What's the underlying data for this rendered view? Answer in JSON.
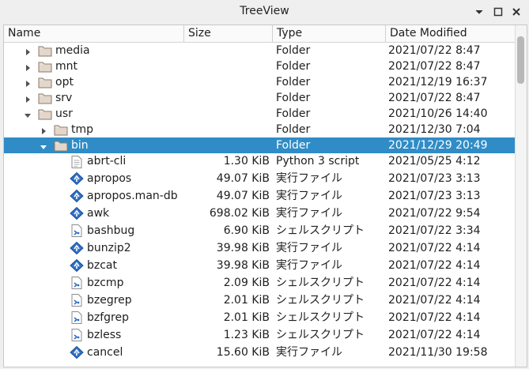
{
  "window": {
    "title": "TreeView"
  },
  "columns": {
    "name": "Name",
    "size": "Size",
    "type": "Type",
    "date": "Date Modified"
  },
  "rows": [
    {
      "name": "media",
      "size": "",
      "type": "Folder",
      "date": "2021/07/22 8:47",
      "depth": 0,
      "kind": "folder",
      "arrow": "right",
      "selected": false
    },
    {
      "name": "mnt",
      "size": "",
      "type": "Folder",
      "date": "2021/07/22 8:47",
      "depth": 0,
      "kind": "folder",
      "arrow": "right",
      "selected": false
    },
    {
      "name": "opt",
      "size": "",
      "type": "Folder",
      "date": "2021/12/19 16:37",
      "depth": 0,
      "kind": "folder",
      "arrow": "right",
      "selected": false
    },
    {
      "name": "srv",
      "size": "",
      "type": "Folder",
      "date": "2021/07/22 8:47",
      "depth": 0,
      "kind": "folder",
      "arrow": "right",
      "selected": false
    },
    {
      "name": "usr",
      "size": "",
      "type": "Folder",
      "date": "2021/10/26 14:40",
      "depth": 0,
      "kind": "folder",
      "arrow": "down",
      "selected": false
    },
    {
      "name": "tmp",
      "size": "",
      "type": "Folder",
      "date": "2021/12/30 7:04",
      "depth": 1,
      "kind": "folder",
      "arrow": "right",
      "selected": false
    },
    {
      "name": "bin",
      "size": "",
      "type": "Folder",
      "date": "2021/12/29 20:49",
      "depth": 1,
      "kind": "folder",
      "arrow": "down",
      "selected": true
    },
    {
      "name": "abrt-cli",
      "size": "1.30 KiB",
      "type": "Python 3 script",
      "date": "2021/05/25 4:12",
      "depth": 2,
      "kind": "text",
      "arrow": "",
      "selected": false
    },
    {
      "name": "apropos",
      "size": "49.07 KiB",
      "type": "実行ファイル",
      "date": "2021/07/23 3:13",
      "depth": 2,
      "kind": "exec",
      "arrow": "",
      "selected": false
    },
    {
      "name": "apropos.man-db",
      "size": "49.07 KiB",
      "type": "実行ファイル",
      "date": "2021/07/23 3:13",
      "depth": 2,
      "kind": "exec",
      "arrow": "",
      "selected": false
    },
    {
      "name": "awk",
      "size": "698.02 KiB",
      "type": "実行ファイル",
      "date": "2021/07/22 9:54",
      "depth": 2,
      "kind": "exec",
      "arrow": "",
      "selected": false
    },
    {
      "name": "bashbug",
      "size": "6.90 KiB",
      "type": "シェルスクリプト",
      "date": "2021/07/22 3:34",
      "depth": 2,
      "kind": "script",
      "arrow": "",
      "selected": false
    },
    {
      "name": "bunzip2",
      "size": "39.98 KiB",
      "type": "実行ファイル",
      "date": "2021/07/22 4:14",
      "depth": 2,
      "kind": "exec",
      "arrow": "",
      "selected": false
    },
    {
      "name": "bzcat",
      "size": "39.98 KiB",
      "type": "実行ファイル",
      "date": "2021/07/22 4:14",
      "depth": 2,
      "kind": "exec",
      "arrow": "",
      "selected": false
    },
    {
      "name": "bzcmp",
      "size": "2.09 KiB",
      "type": "シェルスクリプト",
      "date": "2021/07/22 4:14",
      "depth": 2,
      "kind": "script",
      "arrow": "",
      "selected": false
    },
    {
      "name": "bzegrep",
      "size": "2.01 KiB",
      "type": "シェルスクリプト",
      "date": "2021/07/22 4:14",
      "depth": 2,
      "kind": "script",
      "arrow": "",
      "selected": false
    },
    {
      "name": "bzfgrep",
      "size": "2.01 KiB",
      "type": "シェルスクリプト",
      "date": "2021/07/22 4:14",
      "depth": 2,
      "kind": "script",
      "arrow": "",
      "selected": false
    },
    {
      "name": "bzless",
      "size": "1.23 KiB",
      "type": "シェルスクリプト",
      "date": "2021/07/22 4:14",
      "depth": 2,
      "kind": "script",
      "arrow": "",
      "selected": false
    },
    {
      "name": "cancel",
      "size": "15.60 KiB",
      "type": "実行ファイル",
      "date": "2021/11/30 19:58",
      "depth": 2,
      "kind": "exec",
      "arrow": "",
      "selected": false
    }
  ]
}
